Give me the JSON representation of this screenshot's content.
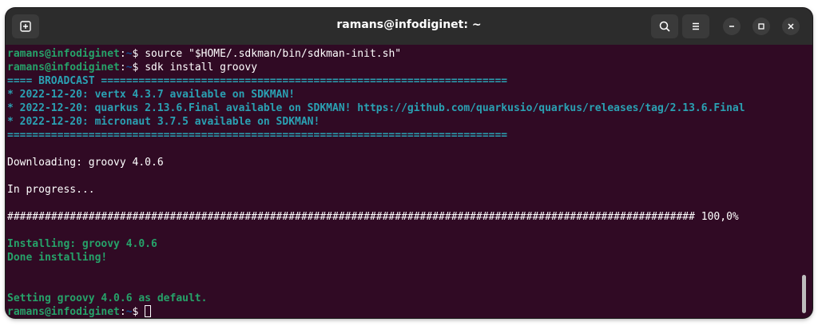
{
  "window": {
    "title": "ramans@infodiginet: ~"
  },
  "icons": {
    "new_tab": "new-tab-icon",
    "search": "search-icon",
    "menu": "hamburger-menu-icon",
    "minimize": "minimize-icon",
    "maximize": "maximize-icon",
    "close": "close-icon"
  },
  "colors": {
    "background": "#300a24",
    "prompt_user": "#26a269",
    "prompt_path": "#12488b",
    "broadcast": "#2aa1b3",
    "status": "#26a269"
  },
  "terminal": {
    "prompt_user": "ramans@infodiginet",
    "prompt_colon": ":",
    "prompt_path": "~",
    "prompt_symbol": "$ ",
    "cmd1": "source \"$HOME/.sdkman/bin/sdkman-init.sh\"",
    "cmd2": "sdk install groovy",
    "broadcast_header": "==== BROADCAST =================================================================",
    "broadcast_1": "* 2022-12-20: vertx 4.3.7 available on SDKMAN!",
    "broadcast_2": "* 2022-12-20: quarkus 2.13.6.Final available on SDKMAN! https://github.com/quarkusio/quarkus/releases/tag/2.13.6.Final",
    "broadcast_3": "* 2022-12-20: micronaut 3.7.5 available on SDKMAN!",
    "broadcast_footer": "================================================================================",
    "downloading": "Downloading: groovy 4.0.6",
    "in_progress": "In progress...",
    "progress_bar": "############################################################################################################## 100,0%",
    "progress_value": 100.0,
    "installing": "Installing: groovy 4.0.6",
    "done": "Done installing!",
    "setting_default": "Setting groovy 4.0.6 as default."
  }
}
